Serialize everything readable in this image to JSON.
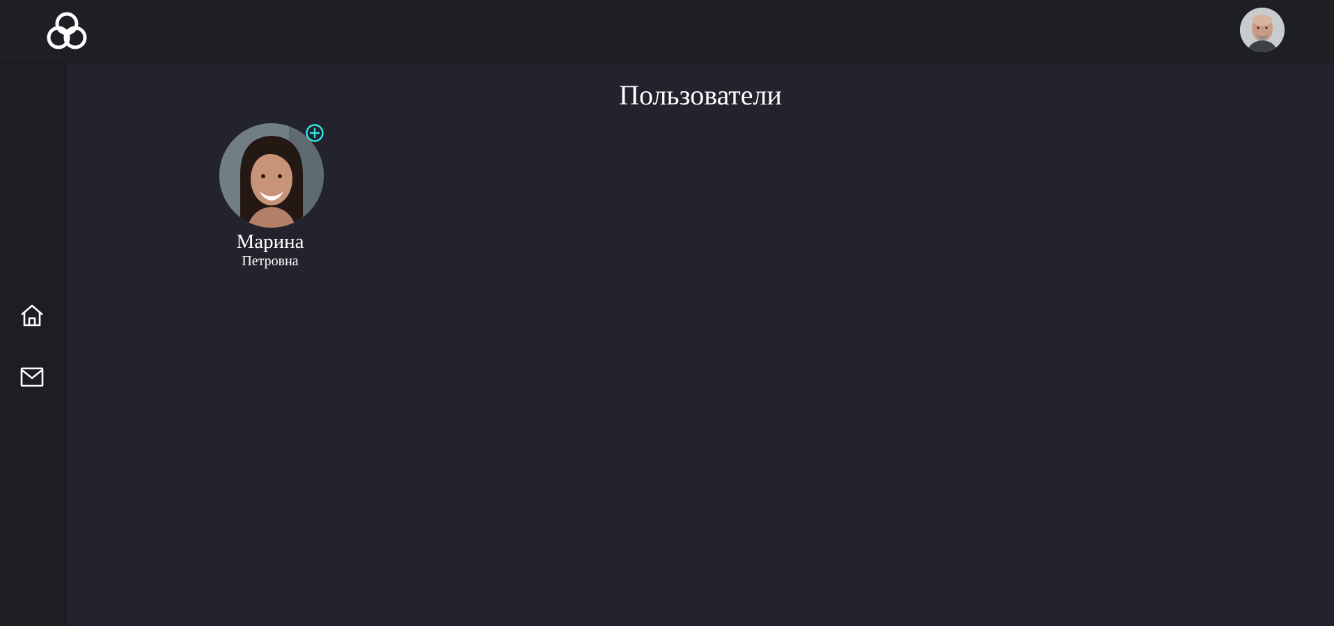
{
  "header": {
    "logo_icon": "knot-logo-icon",
    "profile_avatar": "user-avatar"
  },
  "sidebar": {
    "items": [
      {
        "name": "home",
        "icon": "home-icon"
      },
      {
        "name": "messages",
        "icon": "mail-icon"
      }
    ]
  },
  "main": {
    "title": "Пользователи",
    "users": [
      {
        "first_name": "Марина",
        "last_name": "Петровна",
        "add_icon": "plus-circle-icon"
      }
    ]
  },
  "colors": {
    "background": "#22232c",
    "topbar": "#1e1f24",
    "sidebar": "#1d1e23",
    "accent": "#2ee6e6",
    "text": "#ffffff"
  }
}
